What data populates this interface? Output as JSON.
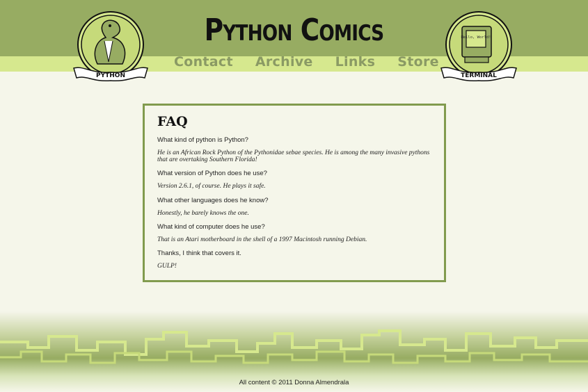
{
  "header": {
    "title": "Python Comics",
    "nav": [
      {
        "label": "Contact"
      },
      {
        "label": "Archive"
      },
      {
        "label": "Links"
      },
      {
        "label": "Store"
      }
    ],
    "left_logo": {
      "banner": "PYTHON"
    },
    "right_logo": {
      "banner": "TERMINAL",
      "screen_text": "Hello, World!"
    }
  },
  "faq": {
    "title": "FAQ",
    "items": [
      {
        "text": "What kind of python is Python?"
      },
      {
        "text": "He is an African Rock Python of the Pythonidae sebae species. He is among the many invasive pythons that are overtaking Southern Florida!"
      },
      {
        "text": "What version of Python does he use?"
      },
      {
        "text": "Version 2.6.1, of course. He plays it safe."
      },
      {
        "text": "What other languages does he know?"
      },
      {
        "text": "Honestly, he barely knows the one."
      },
      {
        "text": "What kind of computer does he use?"
      },
      {
        "text": "That is an Atari motherboard in the shell of a 1997 Macintosh running Debian."
      },
      {
        "text": "Thanks, I think that covers it."
      },
      {
        "text": "GULP!"
      }
    ]
  },
  "footer": {
    "text": "All content © 2011 Donna Almendrala"
  },
  "colors": {
    "header_green": "#97ac62",
    "nav_band": "#d6e88e",
    "page_bg": "#f5f6ea",
    "box_border": "#819b4e",
    "nav_text": "#8a9a64"
  }
}
